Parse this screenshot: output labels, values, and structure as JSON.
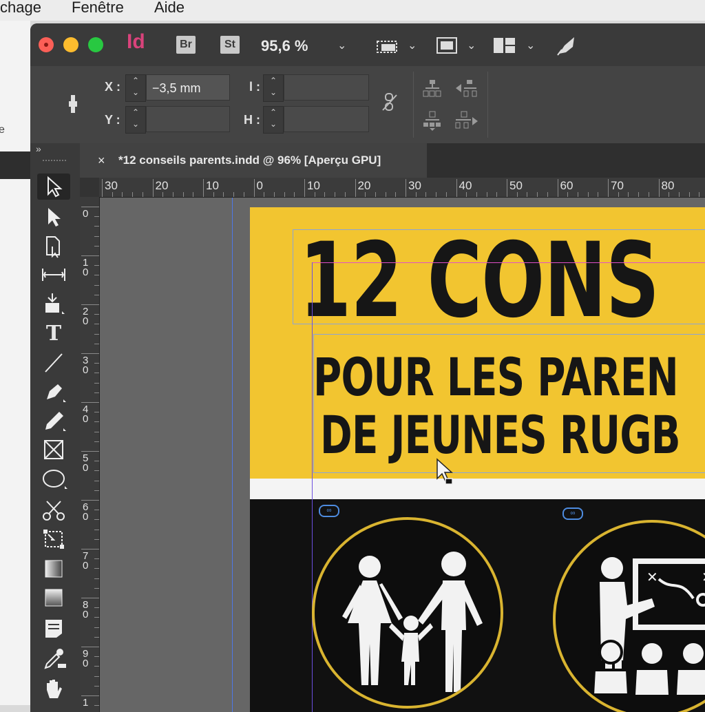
{
  "menubar": {
    "items": [
      "chage",
      "Fenêtre",
      "Aide"
    ]
  },
  "titlebar": {
    "app_logo": "Id",
    "bridge_badge": "Br",
    "stock_badge": "St",
    "zoom": "95,6 %",
    "icons": [
      "screen-mode-icon",
      "view-options-icon",
      "arrange-documents-icon",
      "publish-online-icon"
    ]
  },
  "control_panel": {
    "x_label": "X :",
    "x_value": "−3,5 mm",
    "y_label": "Y :",
    "y_value": "",
    "w_label": "l :",
    "w_value": "",
    "h_label": "H :",
    "h_value": ""
  },
  "tools_panel": {
    "collapse": "»"
  },
  "document_tab": {
    "close": "×",
    "title": "*12 conseils parents.indd @ 96% [Aperçu GPU]"
  },
  "ruler_h": [
    "30",
    "20",
    "10",
    "0",
    "10",
    "20",
    "30",
    "40",
    "50",
    "60",
    "70",
    "80"
  ],
  "ruler_v": [
    "0",
    "1\n0",
    "2\n0",
    "3\n0",
    "4\n0",
    "5\n0",
    "6\n0",
    "7\n0",
    "8\n0",
    "9\n0",
    "1"
  ],
  "poster": {
    "headline": "12 CONS",
    "line2": "POUR LES PAREN",
    "line3": "DE JEUNES RUGB",
    "colors": {
      "yellow": "#f2c530",
      "black": "#111111",
      "ring": "#d9b430"
    },
    "icons": [
      "family-icon",
      "coach-whiteboard-icon"
    ]
  }
}
